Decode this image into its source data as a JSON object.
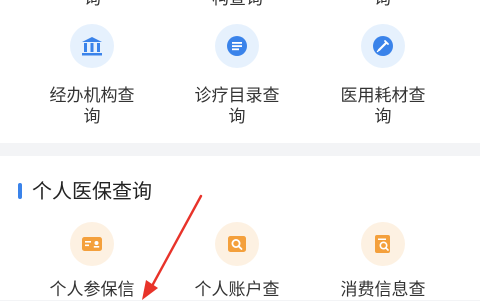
{
  "top_row_partial": [
    "询",
    "构查询",
    "询"
  ],
  "service_items": [
    {
      "label": "经办机构查询",
      "icon": "bank-icon"
    },
    {
      "label": "诊疗目录查询",
      "icon": "list-doc-icon"
    },
    {
      "label": "医用耗材查询",
      "icon": "syringe-icon"
    }
  ],
  "personal_section": {
    "title": "个人医保查询",
    "items": [
      {
        "label": "个人参保信",
        "icon": "id-card-icon"
      },
      {
        "label": "个人账户查",
        "icon": "account-search-icon"
      },
      {
        "label": "消费信息查",
        "icon": "receipt-search-icon"
      }
    ]
  },
  "colors": {
    "accent_blue": "#3a83ea",
    "icon_orange": "#f4a03c",
    "annotation_red": "#e8332a"
  }
}
